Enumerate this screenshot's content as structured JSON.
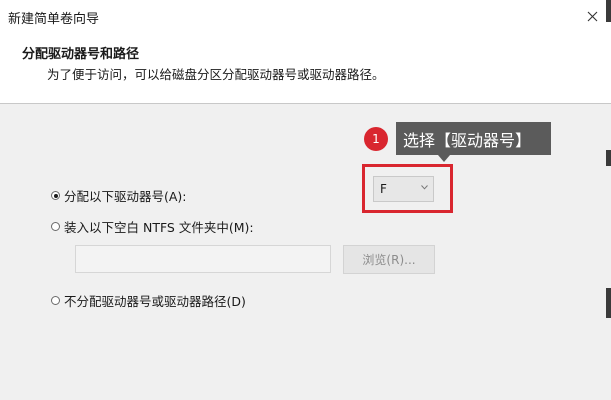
{
  "window": {
    "title": "新建简单卷向导"
  },
  "header": {
    "title": "分配驱动器号和路径",
    "subtitle": "为了便于访问，可以给磁盘分区分配驱动器号或驱动器路径。"
  },
  "annotation": {
    "step_number": "1",
    "tooltip_text": "选择【驱动器号】",
    "highlight_color": "#d9262f"
  },
  "options": {
    "assign_letter": {
      "label": "分配以下驱动器号(A):",
      "checked": true
    },
    "mount_folder": {
      "label": "装入以下空白 NTFS 文件夹中(M):",
      "checked": false
    },
    "no_assign": {
      "label": "不分配驱动器号或驱动器路径(D)",
      "checked": false
    }
  },
  "drive_letter_select": {
    "value": "F",
    "icon": "chevron-down-icon"
  },
  "folder_path": {
    "value": ""
  },
  "browse_button": {
    "label": "浏览(R)..."
  },
  "icons": {
    "close": "close-icon"
  }
}
